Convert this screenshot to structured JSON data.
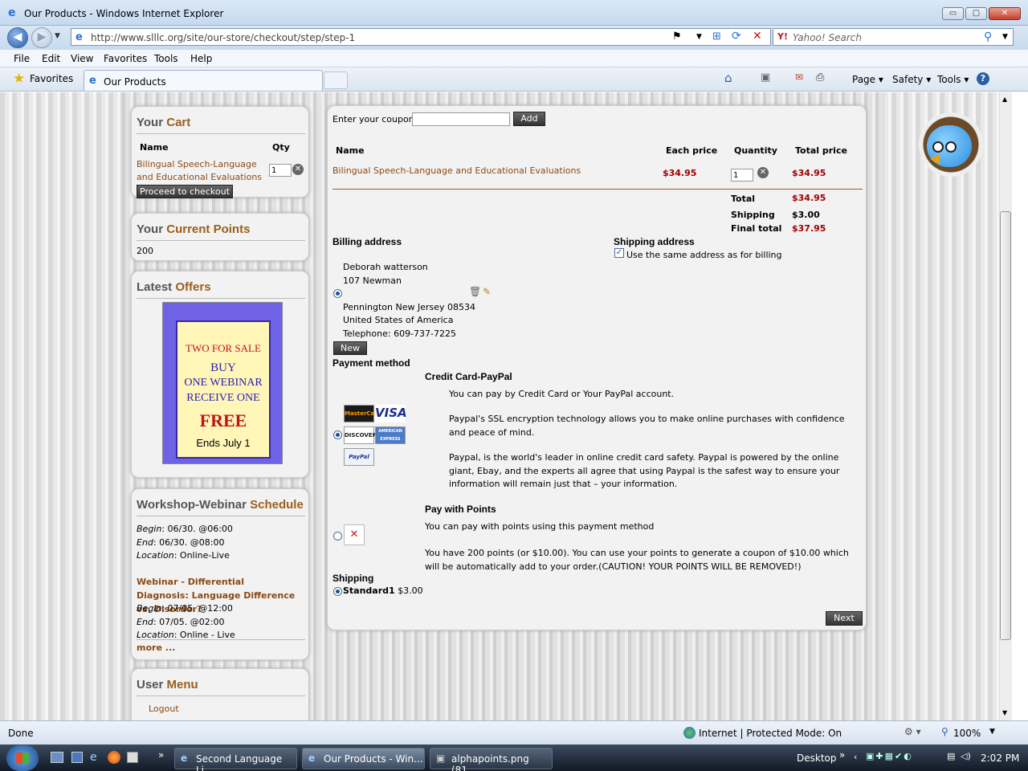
{
  "window": {
    "title": "Our Products - Windows Internet Explorer",
    "min": "▭",
    "max": "▢",
    "close": "✕"
  },
  "address": {
    "url": "http://www.slllc.org/site/our-store/checkout/step/step-1",
    "search_placeholder": "Yahoo! Search"
  },
  "menu": [
    "File",
    "Edit",
    "View",
    "Favorites",
    "Tools",
    "Help"
  ],
  "favbar": {
    "favorites": "Favorites",
    "tab": "Our Products",
    "page": "Page ▾",
    "safety": "Safety ▾",
    "tools": "Tools ▾"
  },
  "cart": {
    "title_a": "Your ",
    "title_b": "Cart",
    "col_name": "Name",
    "col_qty": "Qty",
    "item": "Bilingual Speech-Language and Educational Evaluations",
    "qty": "1",
    "checkout": "Proceed to checkout"
  },
  "points": {
    "title_a": "Your ",
    "title_b": "Current Points",
    "value": "200"
  },
  "offers": {
    "title_a": "Latest ",
    "title_b": "Offers",
    "l1": "TWO FOR SALE",
    "l2": "BUY",
    "l3": "ONE WEBINAR",
    "l4": "RECEIVE ONE",
    "l5": "FREE",
    "l6": "Ends July 1"
  },
  "schedule": {
    "title_a": "Workshop-Webinar ",
    "title_b": "Schedule",
    "e1_begin_l": "Begin",
    "e1_begin": ": 06/30. @06:00",
    "e1_end_l": "End",
    "e1_end": ": 06/30. @08:00",
    "e1_loc_l": "Location",
    "e1_loc": ": Online-Live",
    "e2_title": "Webinar - Differential Diagnosis: Language Difference vs. Disorder?",
    "e2_begin_l": "Begin",
    "e2_begin": ": 07/05. @12:00",
    "e2_end_l": "End",
    "e2_end": ": 07/05. @02:00",
    "e2_loc_l": "Location",
    "e2_loc": ": Online - Live",
    "more": "more ..."
  },
  "usermenu": {
    "title_a": "User ",
    "title_b": "Menu",
    "logout": "Logout"
  },
  "checkout": {
    "coupon_label": "Enter your coupon",
    "coupon_value": "",
    "add": "Add",
    "h_name": "Name",
    "h_each": "Each price",
    "h_qty": "Quantity",
    "h_total": "Total price",
    "item": "Bilingual Speech-Language and Educational Evaluations",
    "each": "$34.95",
    "qty": "1",
    "total": "$34.95",
    "t_total_l": "Total",
    "t_total": "$34.95",
    "t_ship_l": "Shipping",
    "t_ship": "$3.00",
    "t_final_l": "Final total",
    "t_final": "$37.95",
    "billing_label": "Billing address",
    "shipping_label": "Shipping address",
    "same_address": "Use the same address as for billing",
    "addr1": "Deborah watterson",
    "addr2": "107 Newman",
    "addr3": "Pennington New Jersey 08534",
    "addr4": "United States of America",
    "addr5": "Telephone: 609-737-7225",
    "new_btn": "New",
    "payment_label": "Payment method",
    "cc_title": "Credit Card-PayPal",
    "cc_p1": "You can pay by Credit Card or Your PayPal account.",
    "cc_p2": "Paypal's SSL encryption technology allows you to make online purchases with confidence and peace of mind.",
    "cc_p3": "Paypal, is the world's leader in online credit card safety. Paypal is powered by the online giant, Ebay, and the experts all agree that using Paypal is the safest way to ensure your information will remain just that – your information.",
    "cards": {
      "mc": "MasterCard",
      "visa": "VISA",
      "disc": "DISCOVER",
      "amex": "AMERICAN EXPRESS",
      "pp": "PayPal"
    },
    "pts_title": "Pay with Points",
    "pts_p1": "You can pay with points using this payment method",
    "pts_p2": "You have 200 points (or $10.00). You can use your points to generate a coupon of $10.00 which will be automatically add to your order.(CAUTION! YOUR POINTS WILL BE REMOVED!)",
    "ship_label": "Shipping",
    "ship_opt": "Standard1",
    "ship_price": "$3.00",
    "next": "Next"
  },
  "status": {
    "text": "Done",
    "zone": "Internet | Protected Mode: On",
    "zoom": "100%"
  },
  "taskbar": {
    "t1": "Second Language Li...",
    "t2": "Our Products - Win...",
    "t3": "alphapoints.png (81...",
    "desktop": "Desktop",
    "clock": "2:02 PM"
  }
}
